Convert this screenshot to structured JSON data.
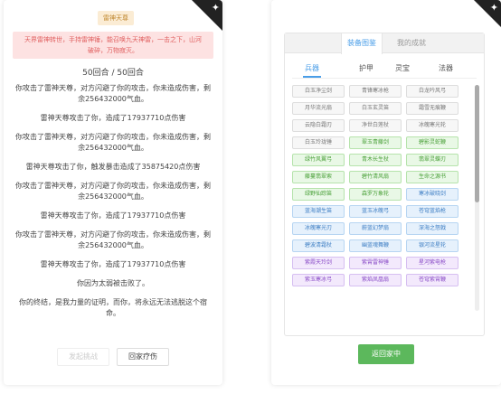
{
  "left": {
    "badge": "雷神天尊",
    "alert": "天界雷神转世，手持雷神锤，能召唤九天神雷，一击之下，山河破碎，万物寂灭。",
    "round": "50回合 / 50回合",
    "log": [
      "你攻击了雷神天尊，对方闪避了你的攻击，你未造成伤害，剩余256432000气血。",
      "雷神天尊攻击了你，造成了17937710点伤害",
      "你攻击了雷神天尊，对方闪避了你的攻击，你未造成伤害，剩余256432000气血。",
      "雷神天尊攻击了你，触发暴击造成了35875420点伤害",
      "你攻击了雷神天尊，对方闪避了你的攻击，你未造成伤害，剩余256432000气血。",
      "雷神天尊攻击了你，造成了17937710点伤害",
      "你攻击了雷神天尊，对方闪避了你的攻击，你未造成伤害，剩余256432000气血。",
      "雷神天尊攻击了你，造成了17937710点伤害",
      "你因为太弱被击败了。",
      "你的终结，是我力量的证明，而你，将永远无法逃脱这个宿命。"
    ],
    "buttons": {
      "challenge": "发起挑战",
      "heal": "回家疗伤"
    }
  },
  "right": {
    "top_tabs": [
      "装备图鉴",
      "我的成就"
    ],
    "sub_tabs": [
      "兵器",
      "护甲",
      "灵宝",
      "法器"
    ],
    "items": [
      [
        {
          "t": "白玉净尘剑",
          "c": "gray"
        },
        {
          "t": "青锋寒冰枪",
          "c": "gray"
        },
        {
          "t": "白龙吟风弓",
          "c": "gray"
        }
      ],
      [
        {
          "t": "月华流光扇",
          "c": "gray"
        },
        {
          "t": "白玉玄灵笛",
          "c": "gray"
        },
        {
          "t": "霜雪无痕鞭",
          "c": "gray"
        }
      ],
      [
        {
          "t": "云隐白霜刃",
          "c": "gray"
        },
        {
          "t": "净世白莲杖",
          "c": "gray"
        },
        {
          "t": "冰魄寒光轮",
          "c": "gray"
        }
      ],
      [
        {
          "t": "白玉玲珑锤",
          "c": "gray"
        },
        {
          "t": "翠玉青藤剑",
          "c": "green"
        },
        {
          "t": "碧影灵蛇鞭",
          "c": "green"
        }
      ],
      [
        {
          "t": "绿竹风翼弓",
          "c": "green"
        },
        {
          "t": "青木长生杖",
          "c": "green"
        },
        {
          "t": "翡翠灵蝶刃",
          "c": "green"
        }
      ],
      [
        {
          "t": "藤蔓翡翠索",
          "c": "green"
        },
        {
          "t": "碧竹清风扇",
          "c": "green"
        },
        {
          "t": "生命之源书",
          "c": "green"
        }
      ],
      [
        {
          "t": "绿野仙踪笛",
          "c": "green"
        },
        {
          "t": "森罗万象轮",
          "c": "green"
        },
        {
          "t": "寒冰破晓剑",
          "c": "blue"
        }
      ],
      [
        {
          "t": "蓝海潮生笛",
          "c": "blue"
        },
        {
          "t": "蓝玉冰魄弓",
          "c": "blue"
        },
        {
          "t": "苍穹蓝焰枪",
          "c": "blue"
        }
      ],
      [
        {
          "t": "冰魄寒光刃",
          "c": "blue"
        },
        {
          "t": "蔚蓝幻梦扇",
          "c": "blue"
        },
        {
          "t": "深海之怒戟",
          "c": "blue"
        }
      ],
      [
        {
          "t": "碧波清霜杖",
          "c": "blue"
        },
        {
          "t": "幽蓝魂舞鞭",
          "c": "blue"
        },
        {
          "t": "银河流星轮",
          "c": "blue"
        }
      ],
      [
        {
          "t": "紫霞天玲剑",
          "c": "purple"
        },
        {
          "t": "紫霄雷神锤",
          "c": "purple"
        },
        {
          "t": "星河紫电枪",
          "c": "purple"
        }
      ],
      [
        {
          "t": "紫玉寒冰弓",
          "c": "purple"
        },
        {
          "t": "紫焰凤凰扇",
          "c": "purple"
        },
        {
          "t": "苍穹紫霄鞭",
          "c": "purple"
        }
      ]
    ],
    "return_button": "返回家中"
  },
  "colors": {
    "accent": "#4a9ee8",
    "green_button": "#5cb85c",
    "alert_bg": "#fde2e2",
    "alert_text": "#e06060"
  },
  "icons": {
    "corner": "gift-icon"
  }
}
